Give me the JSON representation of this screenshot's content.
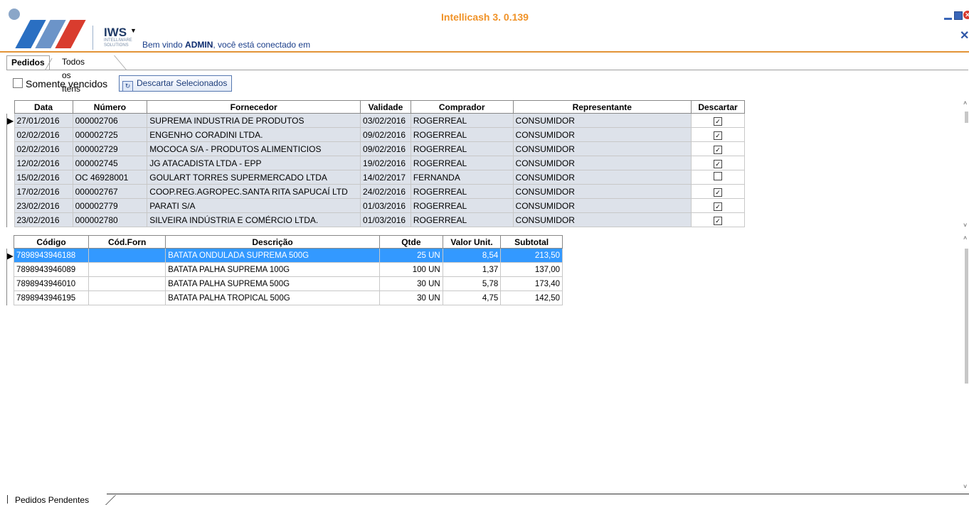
{
  "app": {
    "title": "Intellicash 3. 0.139",
    "brand": "IWS",
    "brand_sub1": "INTELLIWARE",
    "brand_sub2": "SOLUTIONS",
    "welcome_prefix": "Bem vindo ",
    "welcome_user": "ADMIN",
    "welcome_suffix": ", você está conectado em"
  },
  "colors": {
    "accent": "#f09227",
    "selection": "#3399ff",
    "row_bg": "#dde2ea"
  },
  "tabs": [
    {
      "label": "Pedidos",
      "active": true
    },
    {
      "label": "Todos os Itens",
      "active": false
    }
  ],
  "toolbar": {
    "only_expired_label": "Somente vencidos",
    "only_expired_checked": false,
    "discard_button_label": "Descartar Selecionados"
  },
  "orders": {
    "columns": [
      "Data",
      "Número",
      "Fornecedor",
      "Validade",
      "Comprador",
      "Representante",
      "Descartar"
    ],
    "rows": [
      {
        "data": "27/01/2016",
        "numero": "000002706",
        "fornecedor": "SUPREMA INDUSTRIA DE PRODUTOS",
        "validade": "03/02/2016",
        "comprador": "ROGERREAL",
        "representante": "CONSUMIDOR",
        "descartar": true
      },
      {
        "data": "02/02/2016",
        "numero": "000002725",
        "fornecedor": "ENGENHO CORADINI LTDA.",
        "validade": "09/02/2016",
        "comprador": "ROGERREAL",
        "representante": "CONSUMIDOR",
        "descartar": true
      },
      {
        "data": "02/02/2016",
        "numero": "000002729",
        "fornecedor": "MOCOCA S/A - PRODUTOS ALIMENTICIOS",
        "validade": "09/02/2016",
        "comprador": "ROGERREAL",
        "representante": "CONSUMIDOR",
        "descartar": true
      },
      {
        "data": "12/02/2016",
        "numero": "000002745",
        "fornecedor": "JG ATACADISTA LTDA - EPP",
        "validade": "19/02/2016",
        "comprador": "ROGERREAL",
        "representante": "CONSUMIDOR",
        "descartar": true
      },
      {
        "data": "15/02/2016",
        "numero": "OC  46928001",
        "fornecedor": "GOULART TORRES SUPERMERCADO LTDA",
        "validade": "14/02/2017",
        "comprador": "FERNANDA",
        "representante": "CONSUMIDOR",
        "descartar": false
      },
      {
        "data": "17/02/2016",
        "numero": "000002767",
        "fornecedor": "COOP.REG.AGROPEC.SANTA RITA SAPUCAÍ LTD",
        "validade": "24/02/2016",
        "comprador": "ROGERREAL",
        "representante": "CONSUMIDOR",
        "descartar": true
      },
      {
        "data": "23/02/2016",
        "numero": "000002779",
        "fornecedor": "PARATI S/A",
        "validade": "01/03/2016",
        "comprador": "ROGERREAL",
        "representante": "CONSUMIDOR",
        "descartar": true
      },
      {
        "data": "23/02/2016",
        "numero": "000002780",
        "fornecedor": "SILVEIRA INDÚSTRIA E COMÉRCIO LTDA.",
        "validade": "01/03/2016",
        "comprador": "ROGERREAL",
        "representante": "CONSUMIDOR",
        "descartar": true
      }
    ]
  },
  "items": {
    "columns": [
      "Código",
      "Cód.Forn",
      "Descrição",
      "Qtde",
      "Valor Unit.",
      "Subtotal"
    ],
    "rows": [
      {
        "codigo": "7898943946188",
        "cod_forn": "",
        "descricao": "BATATA ONDULADA SUPREMA 500G",
        "qtde": "25 UN",
        "valor_unit": "8,54",
        "subtotal": "213,50",
        "selected": true
      },
      {
        "codigo": "7898943946089",
        "cod_forn": "",
        "descricao": "BATATA PALHA SUPREMA 100G",
        "qtde": "100 UN",
        "valor_unit": "1,37",
        "subtotal": "137,00",
        "selected": false
      },
      {
        "codigo": "7898943946010",
        "cod_forn": "",
        "descricao": "BATATA PALHA SUPREMA 500G",
        "qtde": "30 UN",
        "valor_unit": "5,78",
        "subtotal": "173,40",
        "selected": false
      },
      {
        "codigo": "7898943946195",
        "cod_forn": "",
        "descricao": "BATATA PALHA TROPICAL 500G",
        "qtde": "30 UN",
        "valor_unit": "4,75",
        "subtotal": "142,50",
        "selected": false
      }
    ]
  },
  "bottom_tab": {
    "label": "Pedidos Pendentes"
  },
  "icons": {
    "dropdown": "chevron-down-icon",
    "discard": "discard-icon",
    "row_indicator": "row-pointer-icon",
    "checked": "checkbox-checked-icon"
  }
}
